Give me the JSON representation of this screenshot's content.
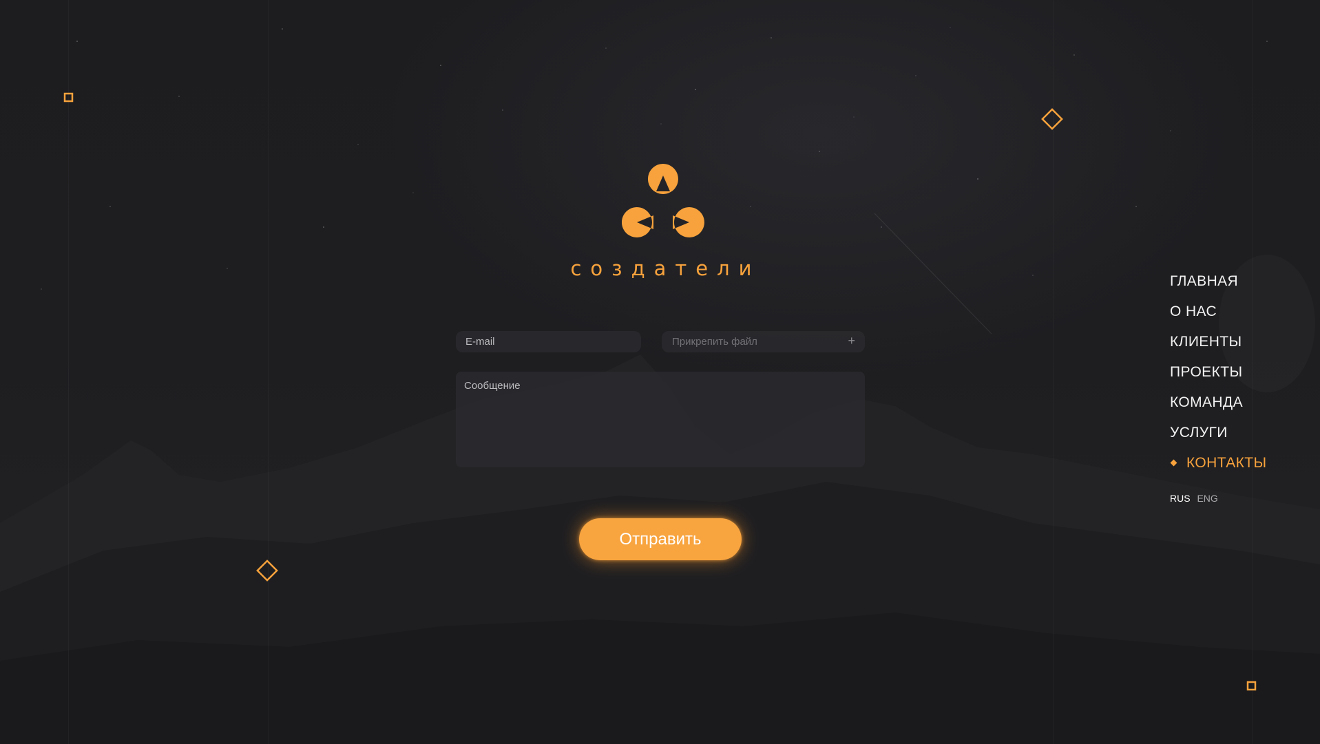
{
  "brand": {
    "name": "создатели",
    "accent_color": "#f7a23c",
    "logo_icon": "three-circle-logo-icon"
  },
  "form": {
    "email_placeholder": "E-mail",
    "attach_placeholder": "Прикрепить файл",
    "attach_icon": "+",
    "message_placeholder": "Сообщение",
    "submit_label": "Отправить"
  },
  "nav": {
    "items": [
      {
        "label": "ГЛАВНАЯ",
        "active": false
      },
      {
        "label": "О НАС",
        "active": false
      },
      {
        "label": "КЛИЕНТЫ",
        "active": false
      },
      {
        "label": "ПРОЕКТЫ",
        "active": false
      },
      {
        "label": "КОМАНДА",
        "active": false
      },
      {
        "label": "УСЛУГИ",
        "active": false
      },
      {
        "label": "КОНТАКТЫ",
        "active": true
      }
    ]
  },
  "languages": {
    "current": "RUS",
    "other": "ENG"
  }
}
